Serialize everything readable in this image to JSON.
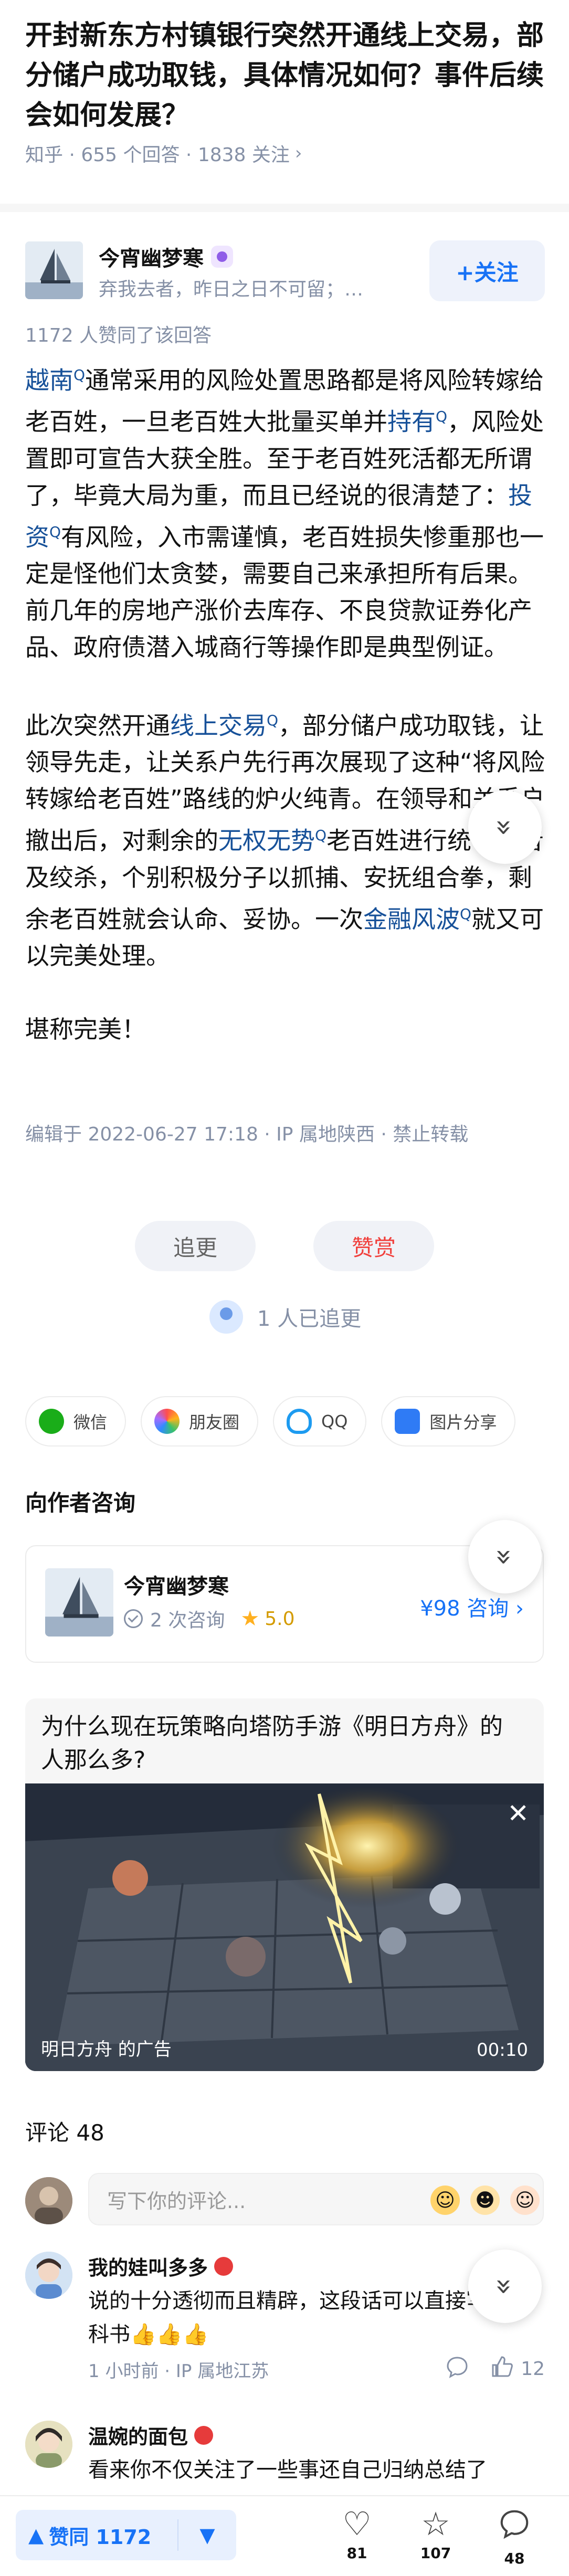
{
  "question": {
    "title": "开封新东方村镇银行突然开通线上交易，部分储户成功取钱，具体情况如何？事件后续会如何发展？",
    "meta": "知乎 · 655 个回答 · 1838 关注",
    "chevron": "›"
  },
  "author": {
    "name": "今宵幽梦寒",
    "bio": "弃我去者，昨日之日不可留；乱…",
    "follow_label": "+关注"
  },
  "upvotes_line": "1172 人赞同了该回答",
  "answer": {
    "p1": {
      "k1": "越南",
      "t1": "通常采用的风险处置思路都是将风险转嫁给老百姓，一旦老百姓大批量买单并",
      "k2": "持有",
      "t2": "，风险处置即可宣告大获全胜。至于老百姓死活都无所谓了，毕竟大局为重，而且已经说的很清楚了：",
      "k3": "投资",
      "t3": "有风险，入市需谨慎，老百姓损失惨重那也一定是怪他们太贪婪，需要自己来承担所有后果。前几年的房地产涨价去库存、不良贷款证券化产品、政府债潜入城商行等操作即是典型例证。"
    },
    "p2": {
      "t1": "此次突然开通",
      "k1": "线上交易",
      "t2": "，部分储户成功取钱，让领导先走，让关系户先行再次展现了这种“将风险转嫁给老百姓”路线的炉火纯青。在领导和关系户撤出后，对剩余的",
      "k2": "无权无势",
      "t3": "老百姓进行统一静音及绞杀，个别积极分子以抓捕、安抚组合拳，剩余老百姓就会认命、妥协。一次",
      "k3": "金融风波",
      "t4": "就又可以完美处理。"
    },
    "p3": "堪称完美！",
    "search_icon": "Q"
  },
  "edit_line": "编辑于 2022-06-27 17:18 · IP 属地陕西 · 禁止转载",
  "actions": {
    "follow_up": "追更",
    "reward": "赞赏"
  },
  "followed_count": "1 人已追更",
  "share": [
    {
      "label": "微信",
      "icon": "wechat-icon"
    },
    {
      "label": "朋友圈",
      "icon": "moments-icon"
    },
    {
      "label": "QQ",
      "icon": "qq-icon"
    },
    {
      "label": "图片分享",
      "icon": "image-share-icon"
    }
  ],
  "consult": {
    "title": "向作者咨询",
    "name": "今宵幽梦寒",
    "count": "2 次咨询",
    "rating": "5.0",
    "price": "¥98 咨询 ›"
  },
  "ad": {
    "title": "为什么现在玩策略向塔防手游《明日方舟》的人那么多?",
    "close": "✕",
    "label": "明日方舟 的广告",
    "duration": "00:10"
  },
  "comments": {
    "title": "评论 48",
    "placeholder": "写下你的评论...",
    "items": [
      {
        "name": "我的娃叫多多",
        "text": "说的十分透彻而且精辟，这段话可以直接写进教科书👍👍👍",
        "meta": "1 小时前 · IP 属地江苏",
        "likes": "12"
      },
      {
        "name": "温婉的面包",
        "text": "看来你不仅关注了一些事还自己归纳总结了"
      }
    ]
  },
  "fab_icon": "»",
  "bottom_bar": {
    "vote_label": "赞同 1172",
    "up_arrow": "▲",
    "down_arrow": "▼",
    "likes_count": "81",
    "favorites_count": "107",
    "comments_count": "48"
  },
  "colors": {
    "brand_blue": "#1772f6",
    "keyword_blue": "#175199",
    "meta_gray": "#8590a6",
    "reward_red": "#f1403c"
  }
}
